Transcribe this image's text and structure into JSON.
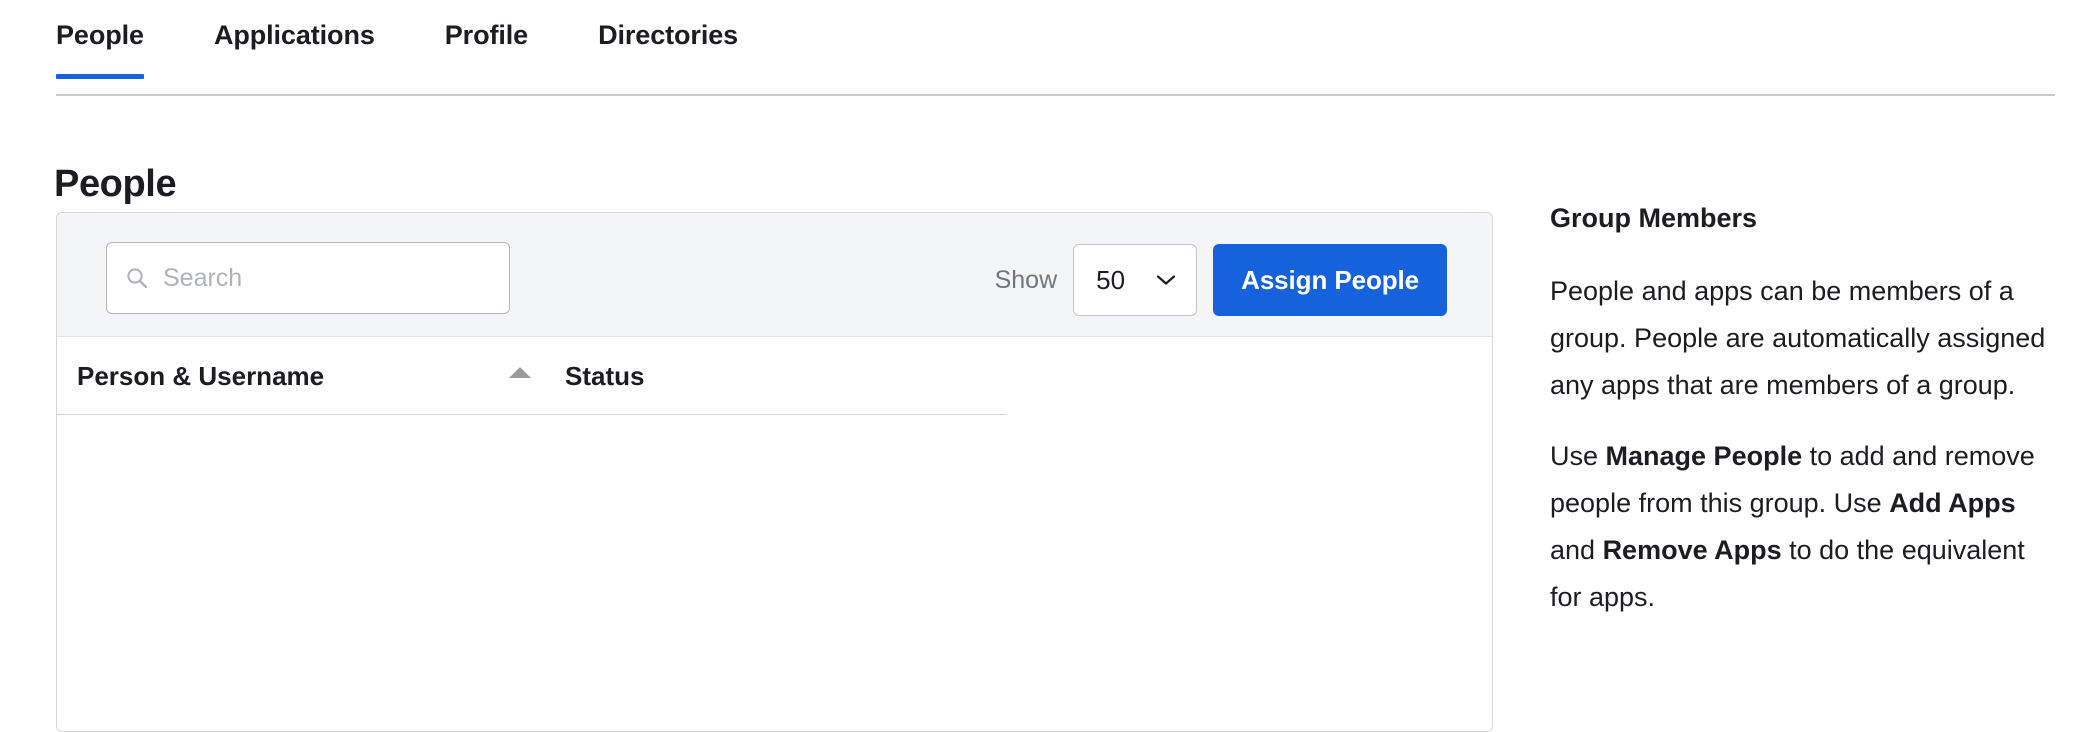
{
  "tabs": [
    {
      "label": "People",
      "active": true
    },
    {
      "label": "Applications",
      "active": false
    },
    {
      "label": "Profile",
      "active": false
    },
    {
      "label": "Directories",
      "active": false
    }
  ],
  "page": {
    "title": "People"
  },
  "toolbar": {
    "search_placeholder": "Search",
    "search_value": "",
    "search_icon": "search-icon",
    "show_label": "Show",
    "page_size_value": "50",
    "page_size_options": [
      "50"
    ],
    "chevron_icon": "chevron-down-icon",
    "assign_button_label": "Assign People"
  },
  "table": {
    "columns": [
      {
        "label": "Person & Username",
        "sorted": "asc",
        "sort_icon": "sort-ascending-icon"
      },
      {
        "label": "Status",
        "sorted": "none"
      }
    ],
    "rows": []
  },
  "info": {
    "title": "Group Members",
    "paragraph_1": "People and apps can be members of a group. People are automatically assigned any apps that are members of a group.",
    "paragraph_2": {
      "part_1": "Use ",
      "bold_1": "Manage People",
      "part_2": " to add and remove people from this group. Use ",
      "bold_2": "Add Apps",
      "part_3": " and ",
      "bold_3": "Remove Apps",
      "part_4": " to do the equivalent for apps."
    }
  },
  "colors": {
    "accent_blue": "#1662dd",
    "toolbar_gray": "#f4f5f6",
    "border_gray": "#d7d7d9",
    "placeholder_gray": "#b0b4ba",
    "muted_text": "#6e7780",
    "text": "#1d1d21"
  }
}
